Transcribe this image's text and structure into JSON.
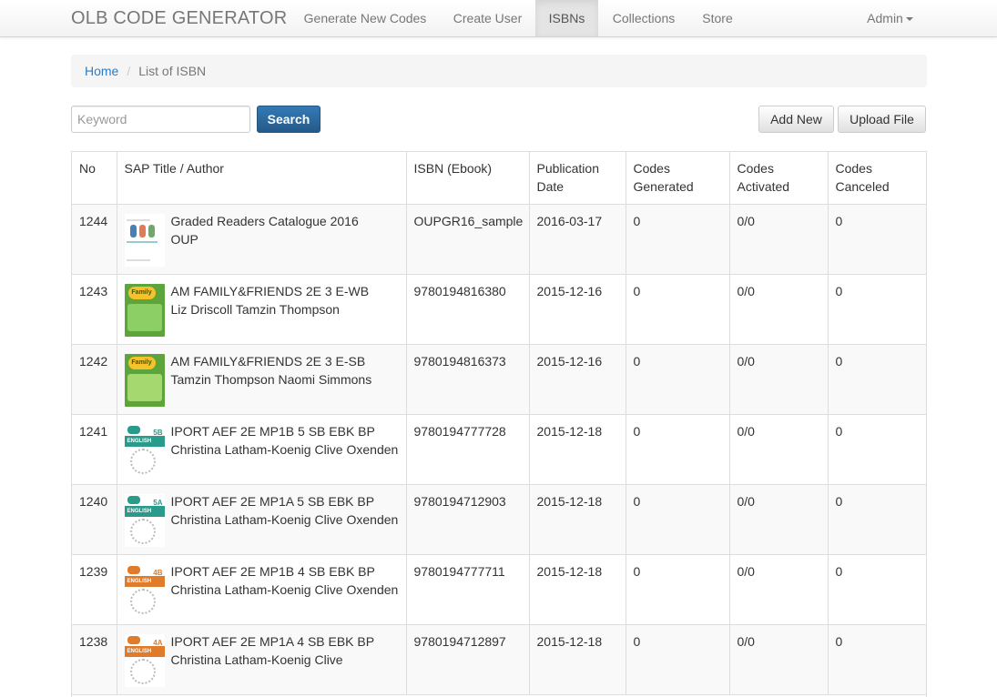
{
  "navbar": {
    "brand": "OLB CODE GENERATOR",
    "items": [
      {
        "label": "Generate New Codes",
        "active": false
      },
      {
        "label": "Create User",
        "active": false
      },
      {
        "label": "ISBNs",
        "active": true
      },
      {
        "label": "Collections",
        "active": false
      },
      {
        "label": "Store",
        "active": false
      }
    ],
    "user_menu": "Admin",
    "user_menu_icon": "caret-down-icon"
  },
  "breadcrumb": {
    "home": "Home",
    "separator": "/",
    "current": "List of ISBN"
  },
  "toolbar": {
    "keyword_placeholder": "Keyword",
    "keyword_value": "",
    "search_label": "Search",
    "add_new_label": "Add New",
    "upload_file_label": "Upload File"
  },
  "table": {
    "headers": {
      "no": "No",
      "title": "SAP Title / Author",
      "isbn": "ISBN (Ebook)",
      "pub_date": "Publication Date",
      "generated": "Codes Generated",
      "activated": "Codes Activated",
      "canceled": "Codes Canceled"
    },
    "rows": [
      {
        "no": "1244",
        "title": "Graded Readers Catalogue 2016",
        "author": "OUP",
        "isbn": "OUPGR16_sample",
        "date": "2016-03-17",
        "generated": "0",
        "activated": "0/0",
        "canceled": "0",
        "cover": "catalogue-cover"
      },
      {
        "no": "1243",
        "title": "AM FAMILY&FRIENDS 2E 3 E-WB",
        "author": "Liz Driscoll Tamzin Thompson",
        "isbn": "9780194816380",
        "date": "2015-12-16",
        "generated": "0",
        "activated": "0/0",
        "canceled": "0",
        "cover": "family-friends-cover"
      },
      {
        "no": "1242",
        "title": "AM FAMILY&FRIENDS 2E 3 E-SB",
        "author": "Tamzin Thompson Naomi Simmons",
        "isbn": "9780194816373",
        "date": "2015-12-16",
        "generated": "0",
        "activated": "0/0",
        "canceled": "0",
        "cover": "family-friends-cover"
      },
      {
        "no": "1241",
        "title": "IPORT AEF 2E MP1B 5 SB EBK BP",
        "author": "Christina Latham-Koenig Clive Oxenden",
        "isbn": "9780194777728",
        "date": "2015-12-18",
        "generated": "0",
        "activated": "0/0",
        "canceled": "0",
        "cover": "english-file-cover",
        "cover_badge": "5B",
        "cover_color": "#2a9a8a"
      },
      {
        "no": "1240",
        "title": "IPORT AEF 2E MP1A 5 SB EBK BP",
        "author": "Christina Latham-Koenig Clive Oxenden",
        "isbn": "9780194712903",
        "date": "2015-12-18",
        "generated": "0",
        "activated": "0/0",
        "canceled": "0",
        "cover": "english-file-cover",
        "cover_badge": "5A",
        "cover_color": "#2a9a8a"
      },
      {
        "no": "1239",
        "title": "IPORT AEF 2E MP1B 4 SB EBK BP",
        "author": "Christina Latham-Koenig Clive Oxenden",
        "isbn": "9780194777711",
        "date": "2015-12-18",
        "generated": "0",
        "activated": "0/0",
        "canceled": "0",
        "cover": "english-file-cover",
        "cover_badge": "4B",
        "cover_color": "#e07b2a"
      },
      {
        "no": "1238",
        "title": "IPORT AEF 2E MP1A 4 SB EBK BP",
        "author": "Christina Latham-Koenig Clive",
        "isbn": "9780194712897",
        "date": "2015-12-18",
        "generated": "0",
        "activated": "0/0",
        "canceled": "0",
        "cover": "english-file-cover",
        "cover_badge": "4A",
        "cover_color": "#e07b2a"
      }
    ]
  },
  "colors": {
    "primary": "#337ab7",
    "link": "#337ab7",
    "stripe": "#f9f9f9",
    "border": "#dddddd"
  }
}
